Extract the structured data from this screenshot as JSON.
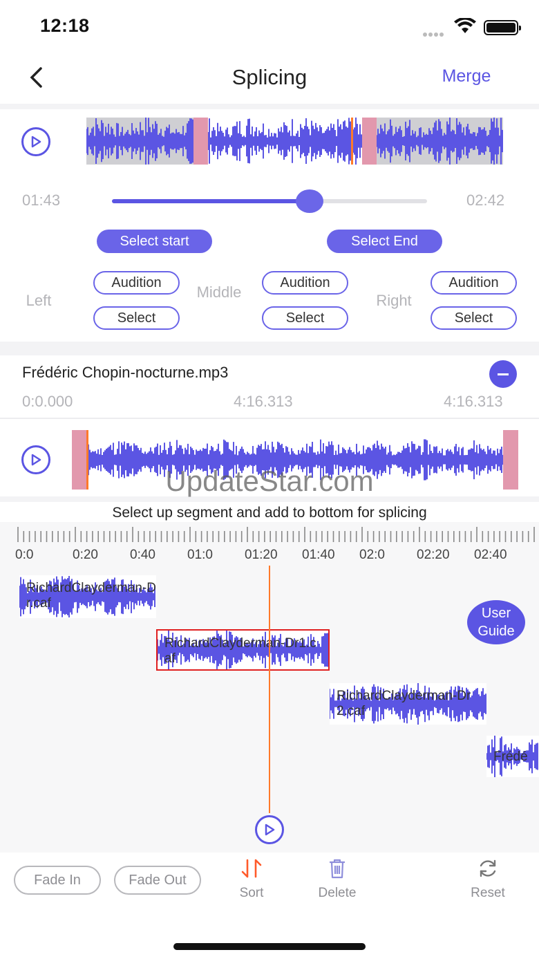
{
  "status_bar": {
    "time": "12:18"
  },
  "nav": {
    "title": "Splicing",
    "merge_label": "Merge"
  },
  "editor": {
    "start_time": "01:43",
    "end_time": "02:42",
    "slider_progress": 0.63,
    "select_start_label": "Select start",
    "select_end_label": "Select End",
    "regions": [
      {
        "label": "Left",
        "audition": "Audition",
        "select": "Select"
      },
      {
        "label": "Middle",
        "audition": "Audition",
        "select": "Select"
      },
      {
        "label": "Right",
        "audition": "Audition",
        "select": "Select"
      }
    ]
  },
  "file": {
    "name": "Frédéric Chopin-nocturne.mp3",
    "time_start": "0:0.000",
    "time_mid": "4:16.313",
    "time_end": "4:16.313"
  },
  "watermark": "UpdateStar.com",
  "timeline": {
    "instructions": "Select up segment and add to bottom for splicing",
    "tick_labels": [
      "0:0",
      "0:20",
      "0:40",
      "01:0",
      "01:20",
      "01:40",
      "02:0",
      "02:20",
      "02:40"
    ],
    "segments": [
      {
        "label": "RichardClayderman-Dr.caf"
      },
      {
        "label": "RichardClayderman-Dr1.caf"
      },
      {
        "label": "RichardClayderman-Dr2.caf"
      },
      {
        "label": "Frédé"
      }
    ],
    "user_guide_label": "User Guide"
  },
  "toolbar": {
    "fade_in": "Fade In",
    "fade_out": "Fade Out",
    "sort": "Sort",
    "delete": "Delete",
    "reset": "Reset"
  },
  "colors": {
    "accent": "#5b55e3",
    "handle": "#e298ad",
    "cursor": "#ff7a2a",
    "selected_border": "#e02020"
  }
}
